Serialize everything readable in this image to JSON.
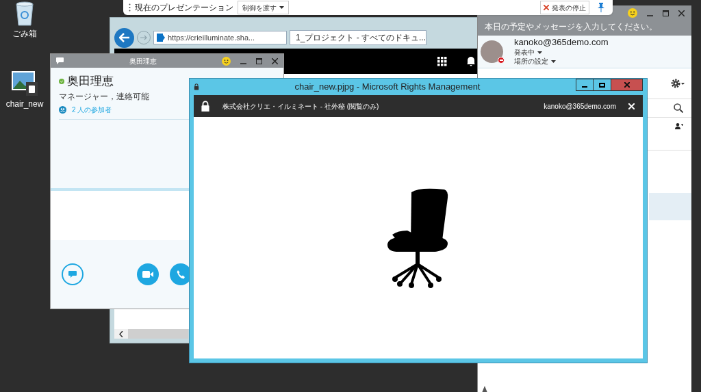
{
  "desktop_icons": [
    {
      "label": "ごみ箱",
      "kind": "recycle"
    },
    {
      "label": "chair_new",
      "kind": "protected-image"
    }
  ],
  "presentation_bar": {
    "title": "現在のプレゼンテーション",
    "control_button": "制御を渡す",
    "stop_button": "発表の停止"
  },
  "browser": {
    "address": "https://crieilluminate.sha...",
    "tab": "1_プロジェクト - すべてのドキュ..."
  },
  "lync": {
    "note": "本日の予定やメッセージを入力してください。",
    "account": "kanoko@365demo.com",
    "status": "発表中",
    "location": "場所の設定"
  },
  "conversation": {
    "title": "奥田理恵",
    "name": "奥田理恵",
    "presence": "マネージャー，連絡可能",
    "participants": "2 人の参加者"
  },
  "viewer": {
    "title": "chair_new.pjpg - Microsoft Rights Management",
    "policy": "株式会社クリエ・イルミネート - 社外秘 (閲覧のみ)",
    "user": "kanoko@365demo.com"
  }
}
